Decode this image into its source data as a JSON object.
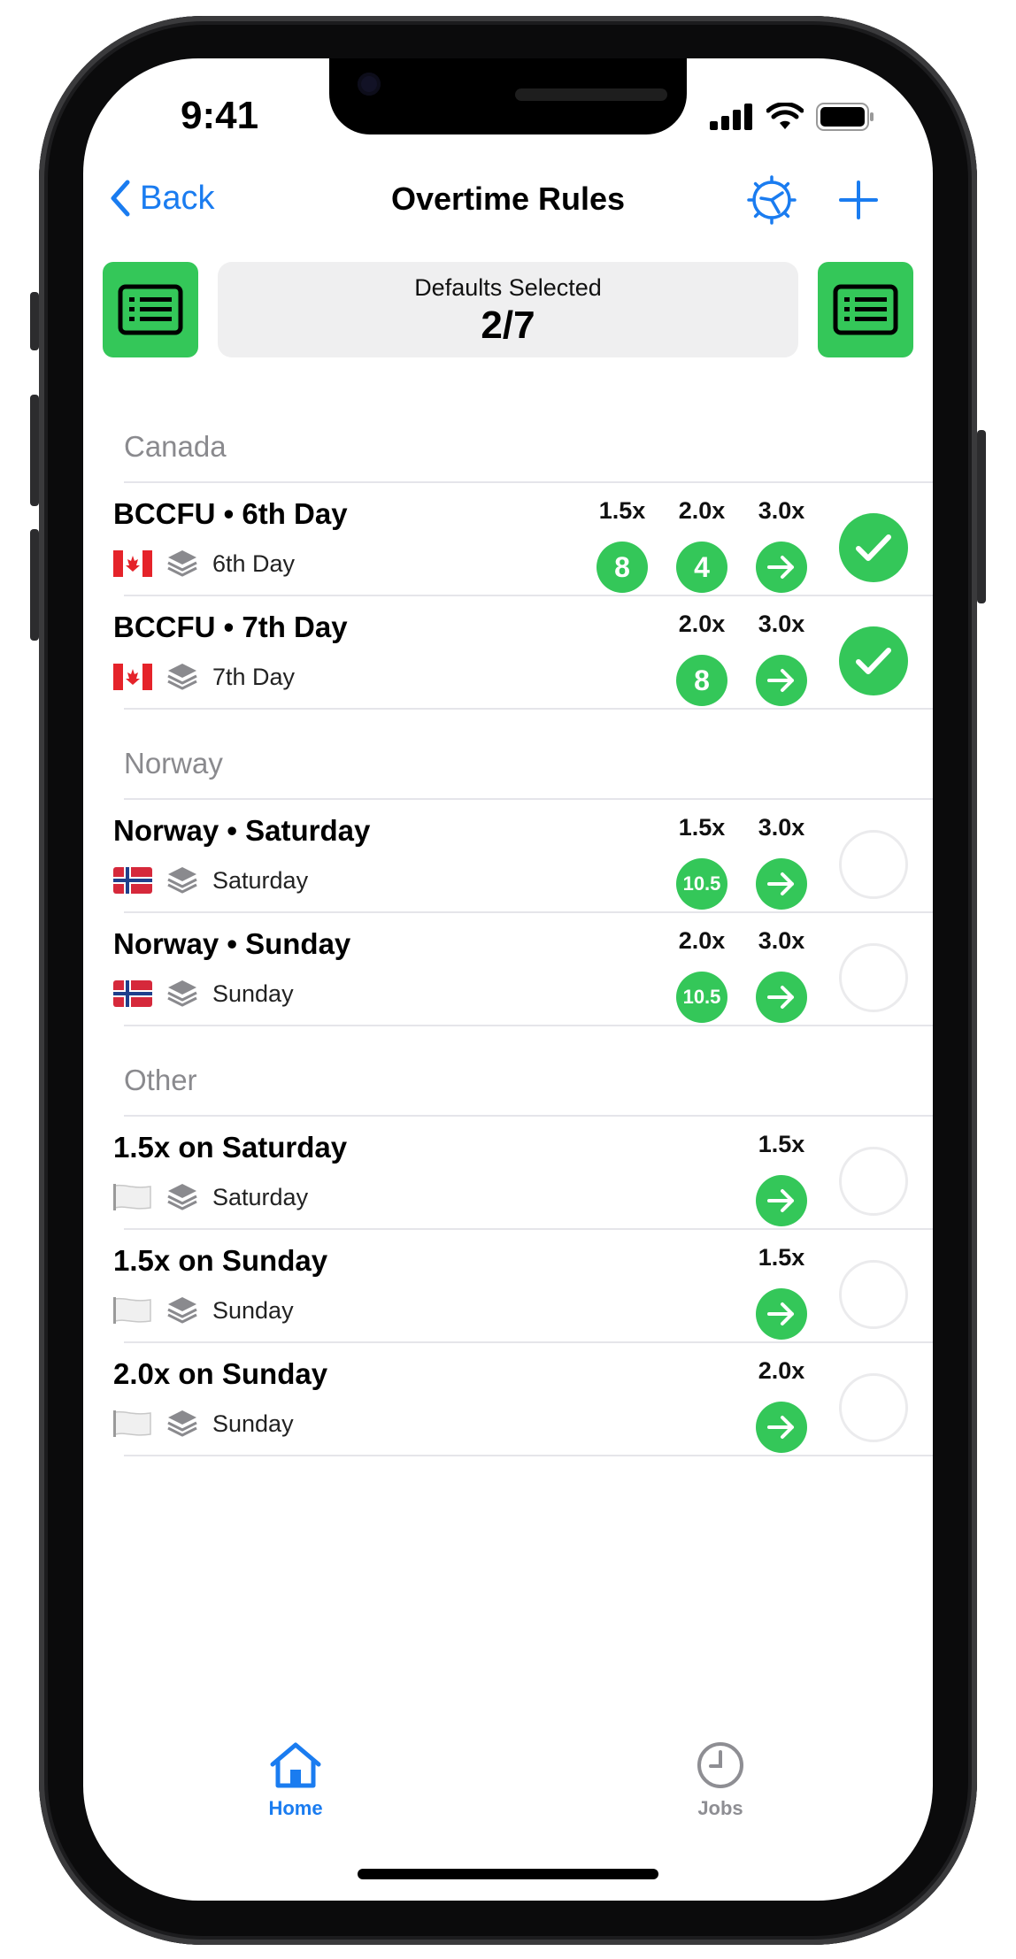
{
  "status": {
    "time": "9:41"
  },
  "nav": {
    "back_label": "Back",
    "title": "Overtime Rules"
  },
  "defaults": {
    "label": "Defaults Selected",
    "count": "2/7"
  },
  "sections": [
    {
      "title": "Canada",
      "rules": [
        {
          "name": "BCCFU • 6th Day",
          "flag": "canada",
          "day": "6th Day",
          "multipliers": [
            {
              "label": "1.5x",
              "value": "8"
            },
            {
              "label": "2.0x",
              "value": "4"
            },
            {
              "label": "3.0x",
              "value": "→"
            }
          ],
          "selected": true
        },
        {
          "name": "BCCFU • 7th Day",
          "flag": "canada",
          "day": "7th Day",
          "multipliers": [
            {
              "label": "2.0x",
              "value": "8"
            },
            {
              "label": "3.0x",
              "value": "→"
            }
          ],
          "selected": true
        }
      ]
    },
    {
      "title": "Norway",
      "rules": [
        {
          "name": "Norway • Saturday",
          "flag": "norway",
          "day": "Saturday",
          "multipliers": [
            {
              "label": "1.5x",
              "value": "10.5"
            },
            {
              "label": "3.0x",
              "value": "→"
            }
          ],
          "selected": false
        },
        {
          "name": "Norway • Sunday",
          "flag": "norway",
          "day": "Sunday",
          "multipliers": [
            {
              "label": "2.0x",
              "value": "10.5"
            },
            {
              "label": "3.0x",
              "value": "→"
            }
          ],
          "selected": false
        }
      ]
    },
    {
      "title": "Other",
      "rules": [
        {
          "name": "1.5x on Saturday",
          "flag": "white",
          "day": "Saturday",
          "multipliers": [
            {
              "label": "1.5x",
              "value": "→"
            }
          ],
          "selected": false
        },
        {
          "name": "1.5x on Sunday",
          "flag": "white",
          "day": "Sunday",
          "multipliers": [
            {
              "label": "1.5x",
              "value": "→"
            }
          ],
          "selected": false
        },
        {
          "name": "2.0x on Sunday",
          "flag": "white",
          "day": "Sunday",
          "multipliers": [
            {
              "label": "2.0x",
              "value": "→"
            }
          ],
          "selected": false
        }
      ]
    }
  ],
  "tabs": [
    {
      "label": "Home",
      "icon": "house-icon",
      "active": true
    },
    {
      "label": "Jobs",
      "icon": "clock-icon",
      "active": false
    }
  ],
  "colors": {
    "accent": "#1a7cf0",
    "green": "#34c759",
    "inactive": "#8e8e93"
  }
}
